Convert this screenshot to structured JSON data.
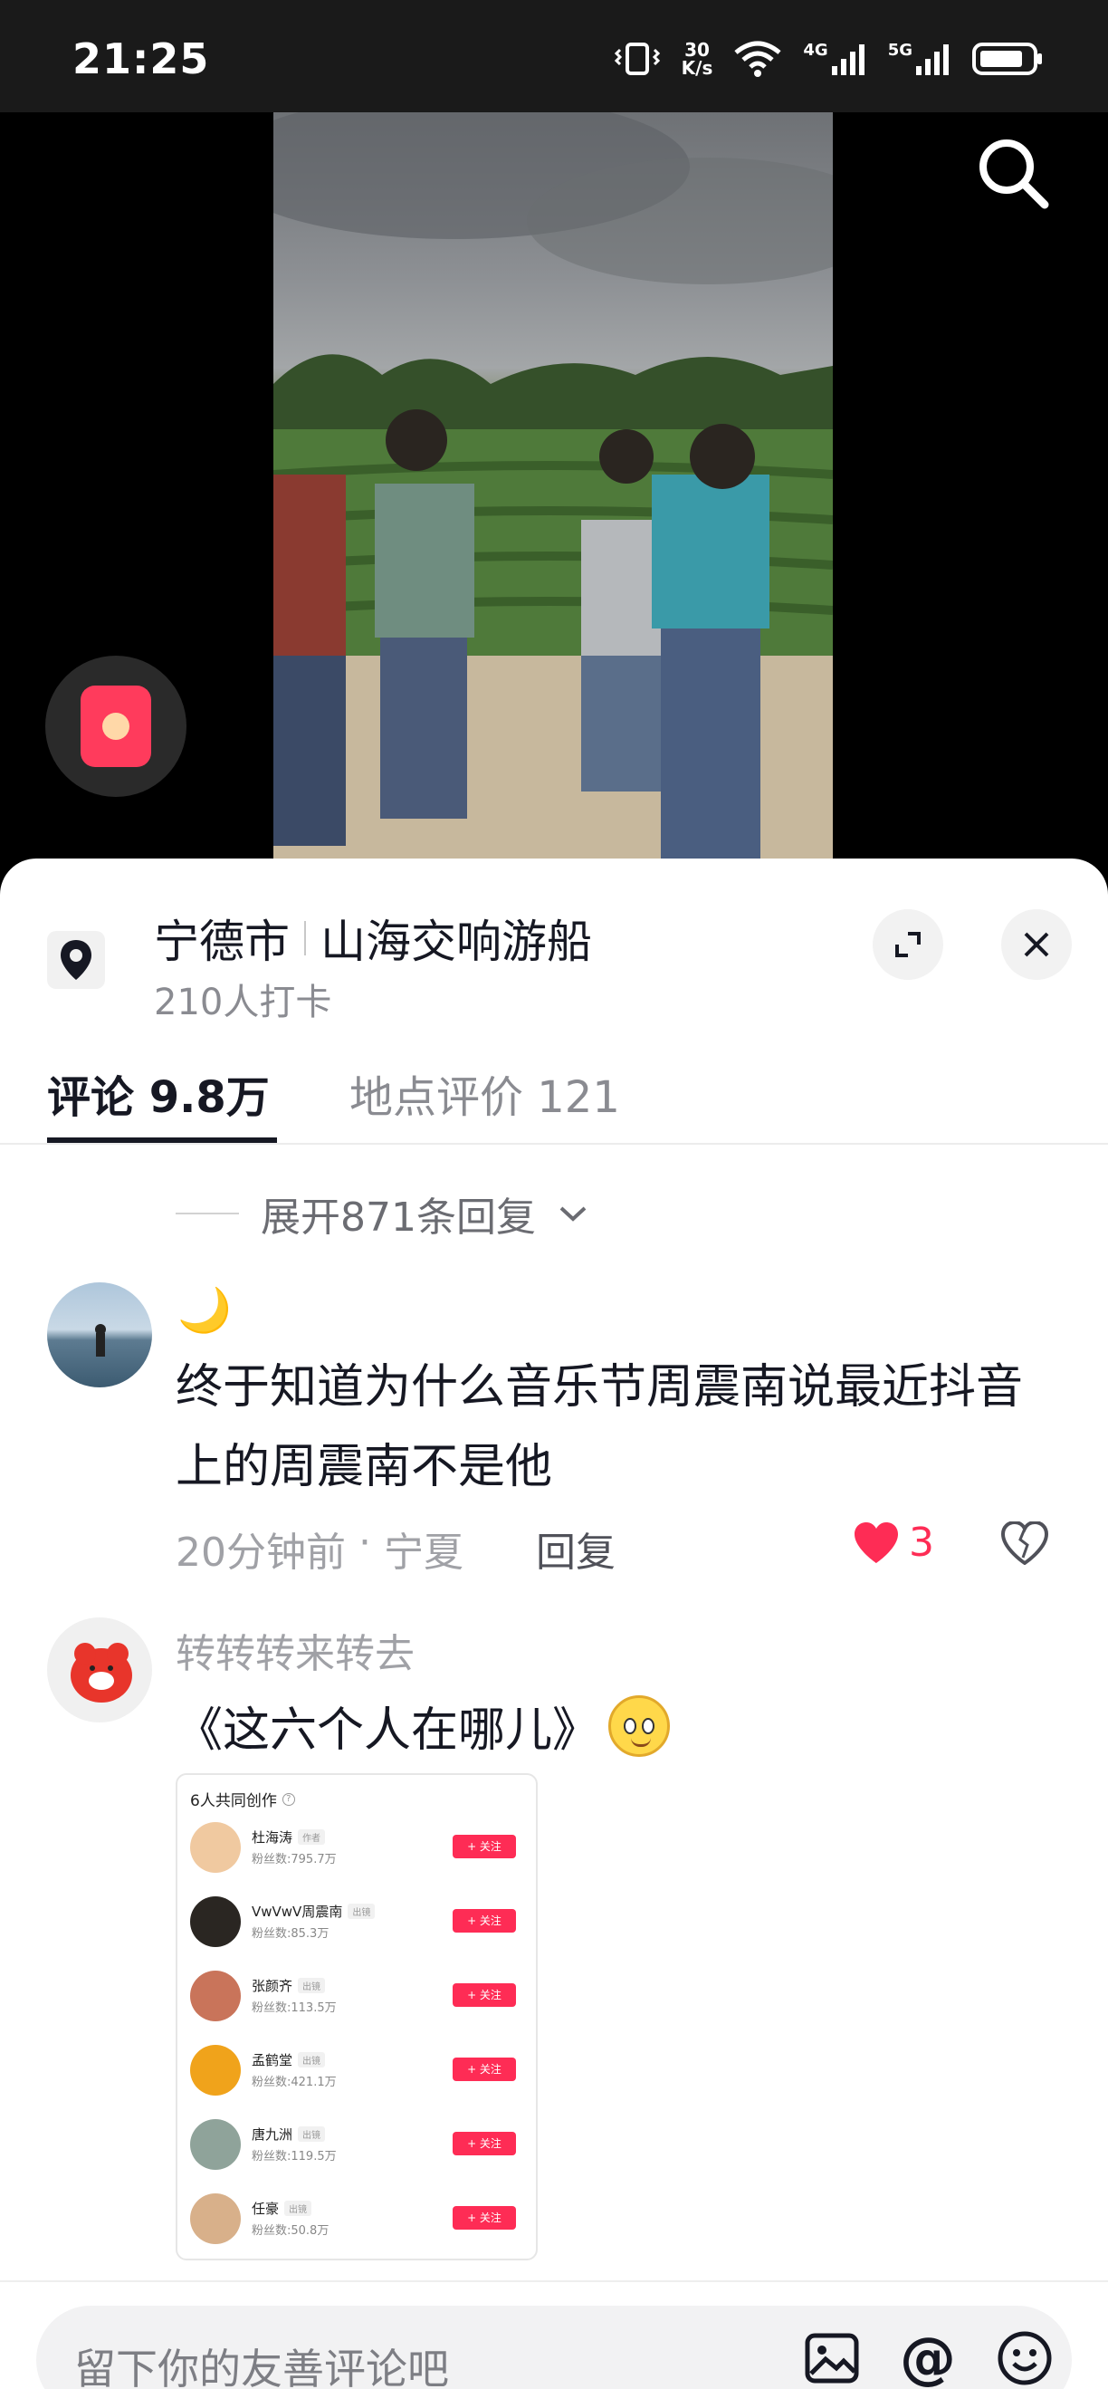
{
  "status_bar": {
    "time": "21:25",
    "speed_top": "30",
    "speed_bottom": "K/s",
    "net1": "4G",
    "net2": "5G"
  },
  "location": {
    "city": "宁德市",
    "place": "山海交响游船",
    "checkins": "210人打卡"
  },
  "tabs": [
    {
      "label": "评论 9.8万",
      "active": true
    },
    {
      "label": "地点评价 121",
      "active": false
    }
  ],
  "expand_replies": "展开871条回复",
  "comments": [
    {
      "username": "🌙",
      "text": "终于知道为什么音乐节周震南说最近抖音上的周震南不是他",
      "time": "20分钟前",
      "dot": "·",
      "region": "宁夏",
      "reply_label": "回复",
      "likes": "3"
    },
    {
      "username": "转转转来转去",
      "text": "《这六个人在哪儿》"
    }
  ],
  "attachment": {
    "title": "6人共同创作",
    "info": "?",
    "creators": [
      {
        "name": "杜海涛",
        "tag": "作者",
        "fans": "粉丝数:795.7万",
        "follow": "+ 关注"
      },
      {
        "name": "VwVwV周震南",
        "tag": "出镜",
        "fans": "粉丝数:85.3万",
        "follow": "+ 关注"
      },
      {
        "name": "张颜齐",
        "tag": "出镜",
        "fans": "粉丝数:113.5万",
        "follow": "+ 关注"
      },
      {
        "name": "孟鹤堂",
        "tag": "出镜",
        "fans": "粉丝数:421.1万",
        "follow": "+ 关注"
      },
      {
        "name": "唐九洲",
        "tag": "出镜",
        "fans": "粉丝数:119.5万",
        "follow": "+ 关注"
      },
      {
        "name": "任豪",
        "tag": "出镜",
        "fans": "粉丝数:50.8万",
        "follow": "+ 关注"
      }
    ]
  },
  "input": {
    "placeholder": "留下你的友善评论吧",
    "at": "@"
  },
  "colors": {
    "accent": "#fe2c55",
    "text": "#161823",
    "muted": "#8a8b91"
  },
  "icons": [
    "search-icon",
    "red-packet-icon",
    "location-pin-icon",
    "expand-icon",
    "close-icon",
    "chevron-down-icon",
    "heart-icon",
    "broken-heart-icon",
    "image-icon",
    "at-icon",
    "emoji-icon"
  ]
}
